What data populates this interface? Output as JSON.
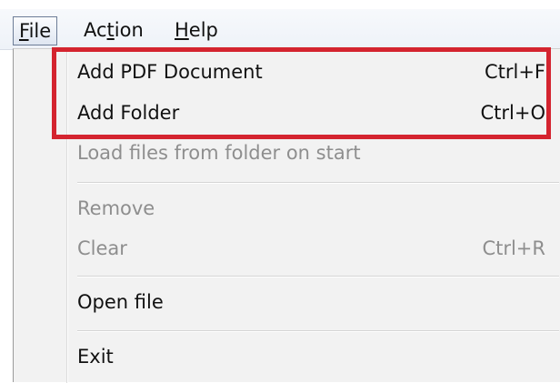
{
  "menubar": {
    "file": "File",
    "action": "Action",
    "help": "Help"
  },
  "dropdown": {
    "items": [
      {
        "label": "Add PDF Document",
        "shortcut": "Ctrl+F",
        "enabled": true
      },
      {
        "label": "Add Folder",
        "shortcut": "Ctrl+O",
        "enabled": true
      },
      {
        "label": "Load files from folder on start",
        "shortcut": "",
        "enabled": false
      },
      {
        "label": "Remove",
        "shortcut": "",
        "enabled": false
      },
      {
        "label": "Clear",
        "shortcut": "Ctrl+R",
        "enabled": false
      },
      {
        "label": "Open file",
        "shortcut": "",
        "enabled": true
      },
      {
        "label": "Exit",
        "shortcut": "",
        "enabled": true
      }
    ]
  },
  "colors": {
    "highlight_border": "#d4242f",
    "disabled_text": "#8e8e8e"
  }
}
